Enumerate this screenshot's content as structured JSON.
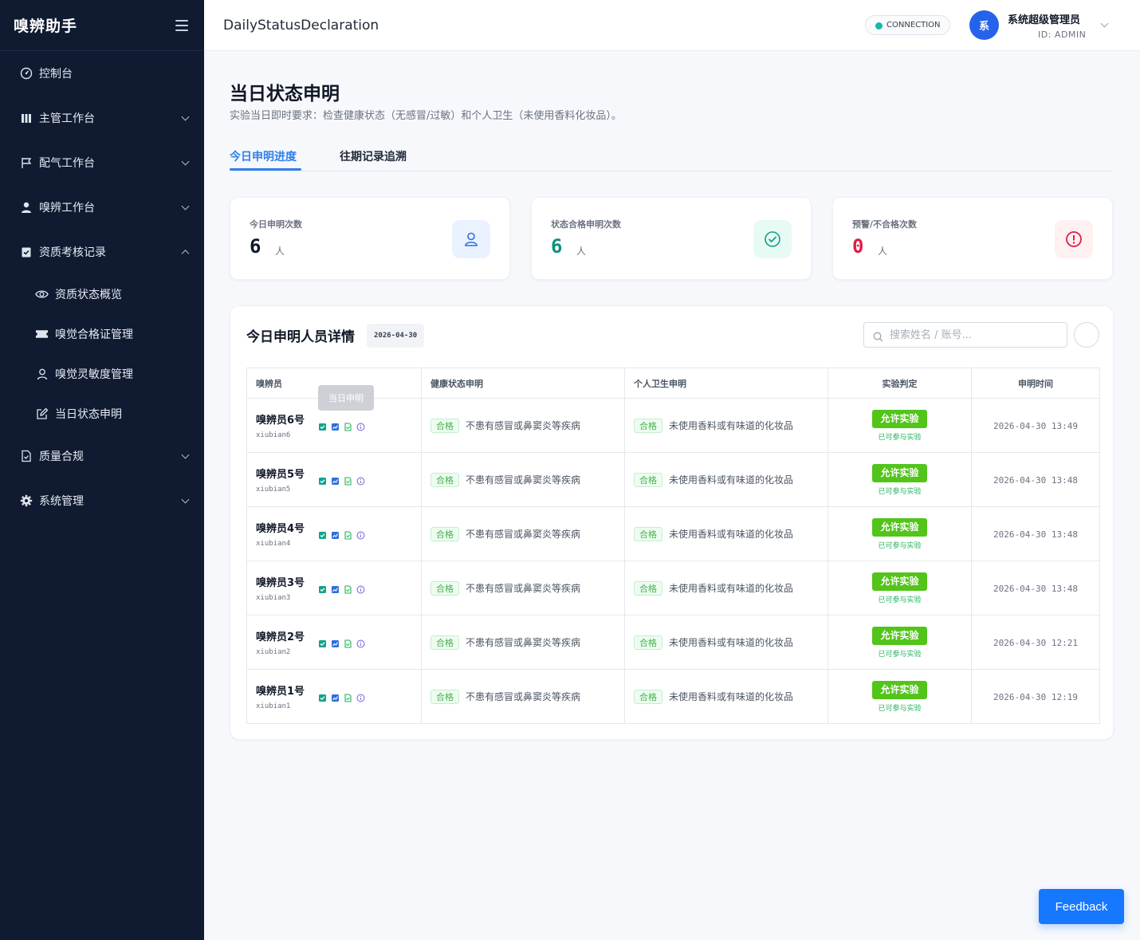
{
  "app": {
    "brand": "嗅辨助手"
  },
  "header": {
    "title": "DailyStatusDeclaration",
    "connection_label": "CONNECTION",
    "avatar_initial": "系",
    "user_name": "系统超级管理员",
    "user_id": "ID: ADMIN"
  },
  "sidebar": {
    "items": [
      {
        "label": "控制台"
      },
      {
        "label": "主管工作台"
      },
      {
        "label": "配气工作台"
      },
      {
        "label": "嗅辨工作台"
      },
      {
        "label": "资质考核记录"
      },
      {
        "label": "质量合规"
      },
      {
        "label": "系统管理"
      }
    ],
    "sub_items": [
      {
        "label": "资质状态概览"
      },
      {
        "label": "嗅觉合格证管理"
      },
      {
        "label": "嗅觉灵敏度管理"
      },
      {
        "label": "当日状态申明"
      }
    ]
  },
  "page": {
    "title": "当日状态申明",
    "subtitle": "实验当日即时要求：检查健康状态（无感冒/过敏）和个人卫生（未使用香料化妆品）。",
    "tabs": [
      {
        "label": "今日申明进度"
      },
      {
        "label": "往期记录追溯"
      }
    ]
  },
  "stats": [
    {
      "label": "今日申明次数",
      "value": "6",
      "unit": "人",
      "color": "#111827"
    },
    {
      "label": "状态合格申明次数",
      "value": "6",
      "unit": "人",
      "color": "#0f8f7e"
    },
    {
      "label": "预警/不合格次数",
      "value": "0",
      "unit": "人",
      "color": "#e11d48"
    }
  ],
  "panel": {
    "title": "今日申明人员详情",
    "date": "2026-04-30",
    "search_placeholder": "搜索姓名 / 账号...",
    "tooltip": "当日申明",
    "columns": [
      "嗅辨员",
      "健康状态申明",
      "个人卫生申明",
      "实验判定",
      "申明时间"
    ],
    "rows": [
      {
        "name": "嗅辨员6号",
        "account": "xiubian6",
        "health_tag": "合格",
        "health_text": "不患有感冒或鼻窦炎等疾病",
        "hygiene_tag": "合格",
        "hygiene_text": "未使用香料或有味道的化妆品",
        "verdict": "允许实验",
        "verdict_sub": "已可参与实验",
        "time": "2026-04-30 13:49"
      },
      {
        "name": "嗅辨员5号",
        "account": "xiubian5",
        "health_tag": "合格",
        "health_text": "不患有感冒或鼻窦炎等疾病",
        "hygiene_tag": "合格",
        "hygiene_text": "未使用香料或有味道的化妆品",
        "verdict": "允许实验",
        "verdict_sub": "已可参与实验",
        "time": "2026-04-30 13:48"
      },
      {
        "name": "嗅辨员4号",
        "account": "xiubian4",
        "health_tag": "合格",
        "health_text": "不患有感冒或鼻窦炎等疾病",
        "hygiene_tag": "合格",
        "hygiene_text": "未使用香料或有味道的化妆品",
        "verdict": "允许实验",
        "verdict_sub": "已可参与实验",
        "time": "2026-04-30 13:48"
      },
      {
        "name": "嗅辨员3号",
        "account": "xiubian3",
        "health_tag": "合格",
        "health_text": "不患有感冒或鼻窦炎等疾病",
        "hygiene_tag": "合格",
        "hygiene_text": "未使用香料或有味道的化妆品",
        "verdict": "允许实验",
        "verdict_sub": "已可参与实验",
        "time": "2026-04-30 13:48"
      },
      {
        "name": "嗅辨员2号",
        "account": "xiubian2",
        "health_tag": "合格",
        "health_text": "不患有感冒或鼻窦炎等疾病",
        "hygiene_tag": "合格",
        "hygiene_text": "未使用香料或有味道的化妆品",
        "verdict": "允许实验",
        "verdict_sub": "已可参与实验",
        "time": "2026-04-30 12:21"
      },
      {
        "name": "嗅辨员1号",
        "account": "xiubian1",
        "health_tag": "合格",
        "health_text": "不患有感冒或鼻窦炎等疾病",
        "hygiene_tag": "合格",
        "hygiene_text": "未使用香料或有味道的化妆品",
        "verdict": "允许实验",
        "verdict_sub": "已可参与实验",
        "time": "2026-04-30 12:19"
      }
    ]
  },
  "feedback": {
    "label": "Feedback"
  },
  "colors": {
    "sidebar_bg": "#101a30",
    "primary": "#2f80ed",
    "success": "#52c41a",
    "danger": "#e11d48"
  }
}
